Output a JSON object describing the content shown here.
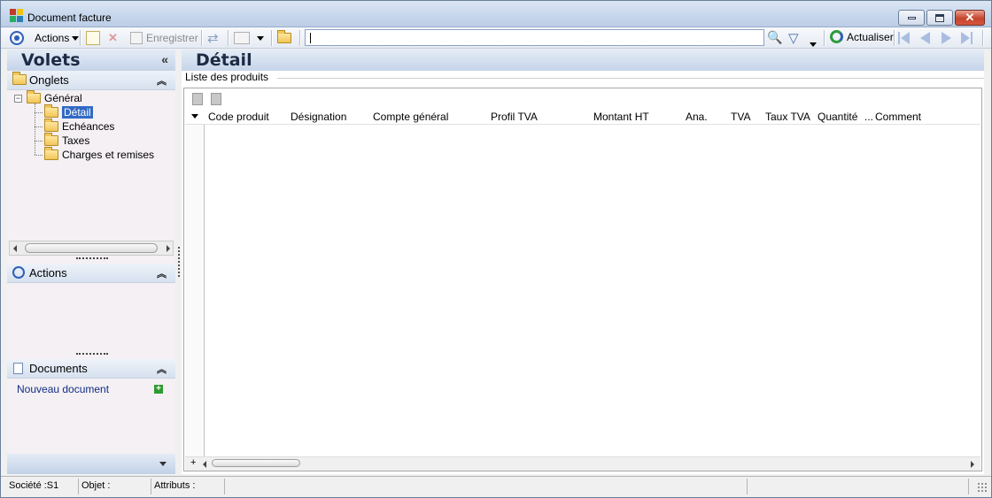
{
  "window": {
    "title": "Document facture"
  },
  "toolbar": {
    "actions_label": "Actions",
    "save_label": "Enregistrer",
    "search_value": "",
    "refresh_label": "Actualiser"
  },
  "left_panel": {
    "title": "Volets",
    "onglets": {
      "title": "Onglets",
      "root": "Général",
      "items": [
        "Détail",
        "Echéances",
        "Taxes",
        "Charges et remises"
      ],
      "selected": "Détail"
    },
    "actions": {
      "title": "Actions"
    },
    "documents": {
      "title": "Documents",
      "new_link": "Nouveau document"
    }
  },
  "main": {
    "title": "Détail",
    "group_label": "Liste des produits",
    "columns": [
      "Code produit",
      "Désignation",
      "Compte général",
      "Profil TVA",
      "Montant HT",
      "Ana.",
      "TVA",
      "Taux TVA",
      "Quantité",
      "...",
      "Comment"
    ],
    "rows": []
  },
  "statusbar": {
    "societe": "Société :S1",
    "objet": "Objet :",
    "attributs": "Attributs :"
  },
  "colors": {
    "accent": "#316ac5",
    "header_gradient_top": "#e4ecf6",
    "header_gradient_bottom": "#c6d5ea"
  }
}
